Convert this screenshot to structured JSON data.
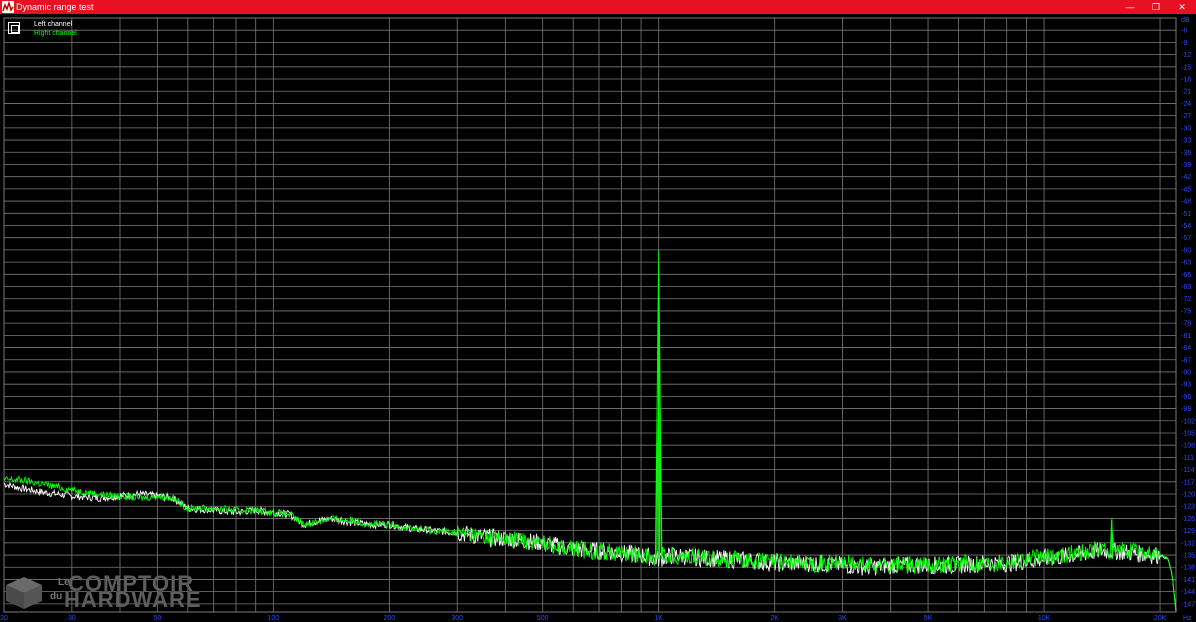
{
  "window": {
    "title": "Dynamic range test",
    "minimize_glyph": "—",
    "restore_glyph": "❐",
    "close_glyph": "✕",
    "icon": "spectrum-app-icon"
  },
  "legend": {
    "left_label": "Left channel",
    "right_label": "Right channel",
    "left_color": "#ffffff",
    "right_color": "#00ff00"
  },
  "watermark": {
    "le": "Le",
    "du": "du",
    "word1": "COMPTOIR",
    "word2": "HARDWARE"
  },
  "colors": {
    "background": "#000000",
    "grid": "#7a7a7a",
    "tick_text": "#2d4bff",
    "titlebar": "#e81123"
  },
  "chart_data": {
    "type": "line",
    "title": "",
    "xlabel": "",
    "ylabel": "",
    "x_unit": "Hz",
    "y_unit": "dB",
    "x_scale": "log",
    "xlim": [
      20,
      22000
    ],
    "ylim": [
      -149,
      -3
    ],
    "grid": true,
    "legend_position": "top-left",
    "x_tick_labels": [
      {
        "v": 20,
        "t": "20"
      },
      {
        "v": 30,
        "t": "30"
      },
      {
        "v": 50,
        "t": "50"
      },
      {
        "v": 100,
        "t": "100"
      },
      {
        "v": 200,
        "t": "200"
      },
      {
        "v": 300,
        "t": "300"
      },
      {
        "v": 500,
        "t": "500"
      },
      {
        "v": 1000,
        "t": "1K"
      },
      {
        "v": 2000,
        "t": "2K"
      },
      {
        "v": 3000,
        "t": "3K"
      },
      {
        "v": 5000,
        "t": "5K"
      },
      {
        "v": 10000,
        "t": "10K"
      },
      {
        "v": 20000,
        "t": "20K"
      }
    ],
    "x_unit_label": "Hz",
    "y_ticks": [
      -6,
      -9,
      -12,
      -15,
      -18,
      -21,
      -24,
      -27,
      -30,
      -33,
      -36,
      -39,
      -42,
      -45,
      -48,
      -51,
      -54,
      -57,
      -60,
      -63,
      -66,
      -69,
      -72,
      -75,
      -78,
      -81,
      -84,
      -87,
      -90,
      -93,
      -96,
      -99,
      -102,
      -105,
      -108,
      -111,
      -114,
      -117,
      -120,
      -123,
      -126,
      -129,
      -132,
      -135,
      -138,
      -141,
      -144,
      -147
    ],
    "y_unit_label": "dB",
    "series": [
      {
        "name": "Left channel",
        "color": "#ffffff",
        "points": [
          [
            20,
            -117.5
          ],
          [
            22,
            -118.5
          ],
          [
            25,
            -119.5
          ],
          [
            30,
            -120.5
          ],
          [
            35,
            -121
          ],
          [
            40,
            -120.5
          ],
          [
            45,
            -120
          ],
          [
            50,
            -120.5
          ],
          [
            55,
            -121
          ],
          [
            60,
            -123.5
          ],
          [
            70,
            -124
          ],
          [
            80,
            -124.5
          ],
          [
            90,
            -124
          ],
          [
            100,
            -124.5
          ],
          [
            110,
            -125
          ],
          [
            120,
            -127.5
          ],
          [
            140,
            -126
          ],
          [
            160,
            -127
          ],
          [
            180,
            -127.5
          ],
          [
            200,
            -127.5
          ],
          [
            230,
            -128.5
          ],
          [
            260,
            -129
          ],
          [
            300,
            -129.5
          ],
          [
            350,
            -130.5
          ],
          [
            400,
            -131
          ],
          [
            450,
            -131.5
          ],
          [
            500,
            -132
          ],
          [
            600,
            -133.5
          ],
          [
            700,
            -134
          ],
          [
            800,
            -134.5
          ],
          [
            900,
            -135
          ],
          [
            1000,
            -136
          ],
          [
            1100,
            -135
          ],
          [
            1200,
            -135.5
          ],
          [
            1500,
            -136
          ],
          [
            1800,
            -136.5
          ],
          [
            2000,
            -137
          ],
          [
            2500,
            -137
          ],
          [
            3000,
            -137.5
          ],
          [
            3500,
            -138
          ],
          [
            4000,
            -137.5
          ],
          [
            5000,
            -137.5
          ],
          [
            6000,
            -137.5
          ],
          [
            7000,
            -137
          ],
          [
            8000,
            -137
          ],
          [
            9000,
            -136.5
          ],
          [
            10000,
            -136
          ],
          [
            12000,
            -135
          ],
          [
            14000,
            -134
          ],
          [
            15000,
            -134
          ],
          [
            17000,
            -134.5
          ],
          [
            19000,
            -135
          ],
          [
            20000,
            -135
          ],
          [
            21000,
            -136
          ],
          [
            21500,
            -140
          ],
          [
            22000,
            -149
          ]
        ]
      },
      {
        "name": "Right channel",
        "color": "#00ff00",
        "points": [
          [
            20,
            -116.5
          ],
          [
            22,
            -116.5
          ],
          [
            25,
            -117.5
          ],
          [
            30,
            -119
          ],
          [
            35,
            -120
          ],
          [
            40,
            -120.5
          ],
          [
            45,
            -121
          ],
          [
            50,
            -120.5
          ],
          [
            55,
            -121
          ],
          [
            60,
            -123.5
          ],
          [
            70,
            -123.5
          ],
          [
            80,
            -124
          ],
          [
            90,
            -124
          ],
          [
            100,
            -124.5
          ],
          [
            110,
            -125
          ],
          [
            120,
            -127.5
          ],
          [
            140,
            -126
          ],
          [
            160,
            -126.5
          ],
          [
            180,
            -127.5
          ],
          [
            200,
            -127.5
          ],
          [
            230,
            -128.5
          ],
          [
            260,
            -129
          ],
          [
            300,
            -129.5
          ],
          [
            350,
            -130.5
          ],
          [
            400,
            -131
          ],
          [
            450,
            -131.5
          ],
          [
            500,
            -132
          ],
          [
            600,
            -133.5
          ],
          [
            700,
            -134
          ],
          [
            800,
            -134.5
          ],
          [
            900,
            -135
          ],
          [
            980,
            -136
          ],
          [
            990,
            -100
          ],
          [
            1000,
            -60
          ],
          [
            1010,
            -100
          ],
          [
            1020,
            -135
          ],
          [
            1100,
            -135
          ],
          [
            1200,
            -135.5
          ],
          [
            1500,
            -136
          ],
          [
            1800,
            -136.5
          ],
          [
            2000,
            -136.5
          ],
          [
            2500,
            -137
          ],
          [
            3000,
            -137
          ],
          [
            3500,
            -137.5
          ],
          [
            4000,
            -137.5
          ],
          [
            5000,
            -137.5
          ],
          [
            6000,
            -137
          ],
          [
            7000,
            -137
          ],
          [
            8000,
            -136.5
          ],
          [
            9000,
            -136
          ],
          [
            10000,
            -135.5
          ],
          [
            12000,
            -134.5
          ],
          [
            14000,
            -133.5
          ],
          [
            14900,
            -134
          ],
          [
            15000,
            -126
          ],
          [
            15100,
            -134
          ],
          [
            17000,
            -134
          ],
          [
            19000,
            -134.5
          ],
          [
            20000,
            -135
          ],
          [
            21000,
            -136
          ],
          [
            21500,
            -140
          ],
          [
            22000,
            -149
          ]
        ]
      }
    ]
  }
}
